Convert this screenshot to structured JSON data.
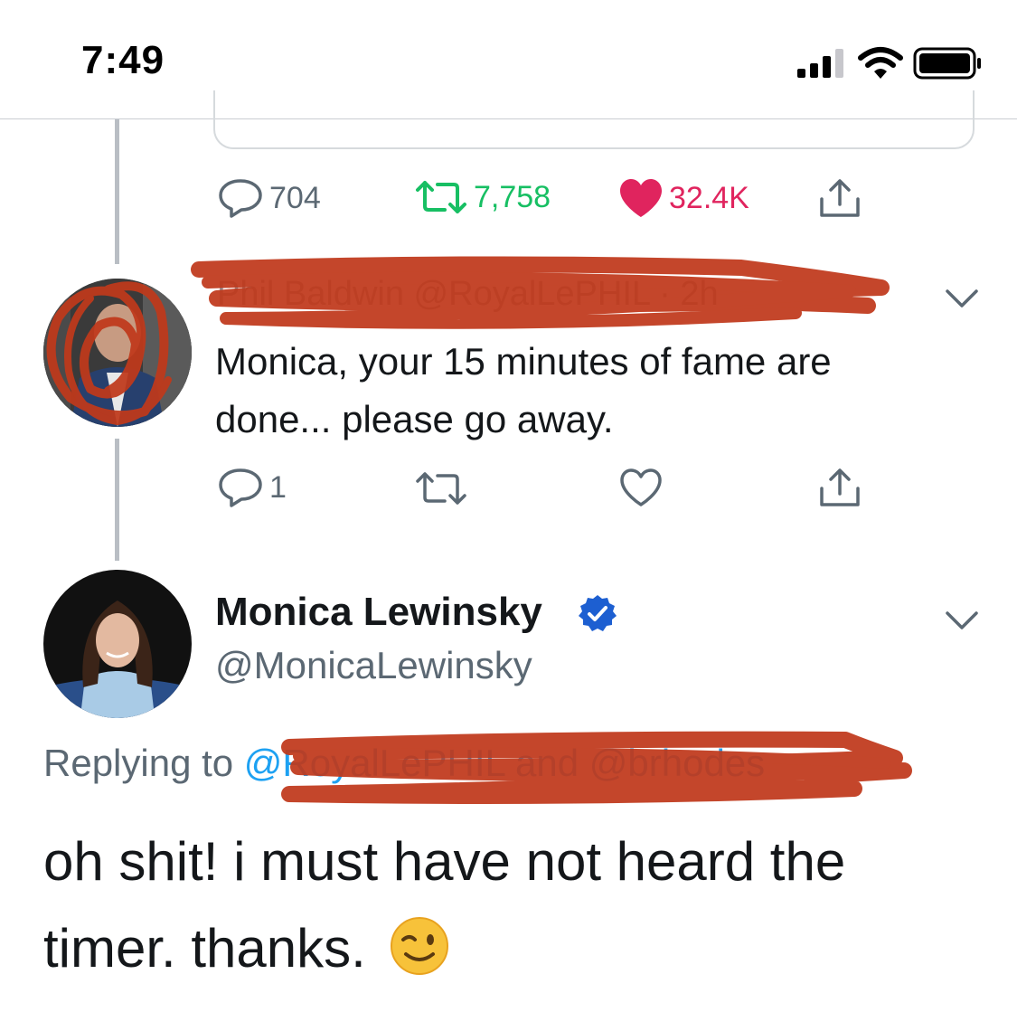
{
  "status_bar": {
    "time": "7:49"
  },
  "first_tweet_actions": {
    "replies": "704",
    "retweets": "7,758",
    "likes": "32.4K"
  },
  "reply_tweet": {
    "header": "Phil Baldwin @RoyalLePHIL · 2h",
    "text": "Monica, your 15 minutes of fame are done... please go away.",
    "replies": "1"
  },
  "main_tweet": {
    "display_name": "Monica Lewinsky",
    "handle": "@MonicaLewinsky",
    "replying_prefix": "Replying to ",
    "replying_mentions": "@RoyalLePHIL and @brhodes",
    "text": "oh shit! i must have not heard the timer. thanks."
  },
  "colors": {
    "retweet_green": "#17bf63",
    "like_red": "#e0245e",
    "link_blue": "#1da1f2",
    "scribble_red": "#c0391b"
  }
}
